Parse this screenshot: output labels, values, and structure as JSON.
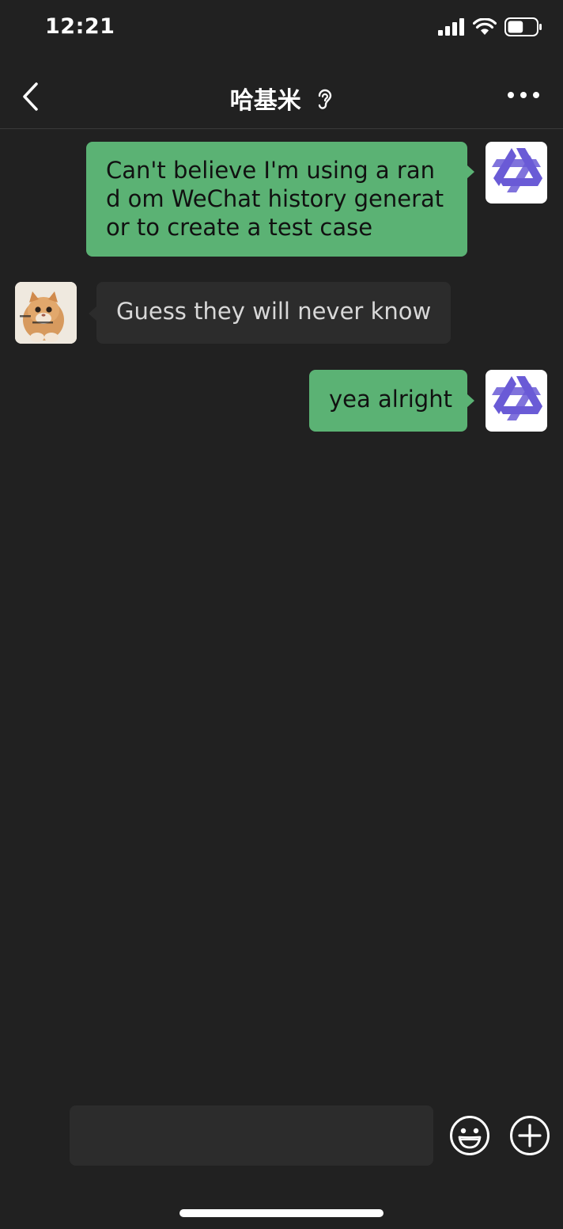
{
  "status_bar": {
    "time": "12:21",
    "icons": [
      "cellular-signal-icon",
      "wifi-icon",
      "battery-icon"
    ],
    "battery_level": 0.55
  },
  "nav": {
    "back_icon": "chevron-left-icon",
    "title": "哈基米",
    "title_icon": "ear-icon",
    "more_icon": "more-dots-icon"
  },
  "messages": [
    {
      "direction": "outgoing",
      "text": "Can't believe I'm using a rand om WeChat history generator to create a test case",
      "avatar": "app-logo-avatar"
    },
    {
      "direction": "incoming",
      "text": "Guess they will never know",
      "avatar": "cat-avatar"
    },
    {
      "direction": "outgoing",
      "text": "yea alright",
      "avatar": "app-logo-avatar"
    }
  ],
  "input_bar": {
    "value": "",
    "emoji_icon": "emoji-icon",
    "plus_icon": "plus-circle-icon"
  },
  "colors": {
    "background": "#212121",
    "outgoing_bubble": "#5bb274",
    "incoming_bubble": "#2c2c2c",
    "app_logo": "#6a5bd6"
  }
}
